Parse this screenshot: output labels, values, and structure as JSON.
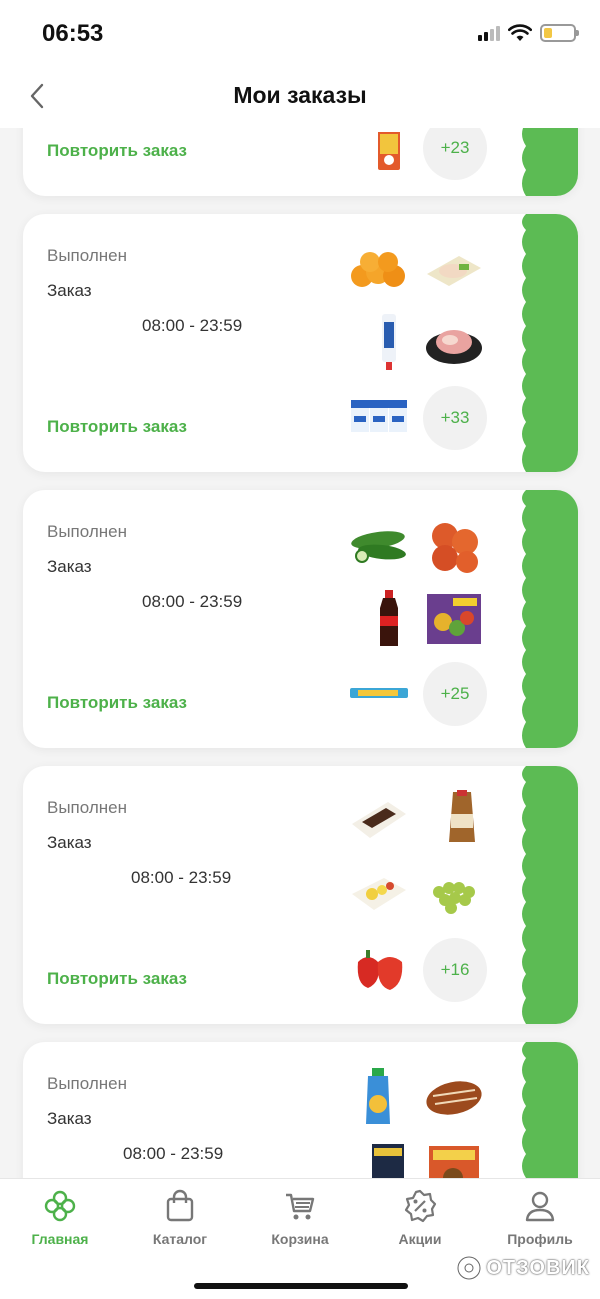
{
  "status_bar": {
    "time": "06:53"
  },
  "header": {
    "title": "Мои заказы"
  },
  "colors": {
    "accent": "#4db14a",
    "brand_strip": "#5cbb54"
  },
  "orders": [
    {
      "status": "",
      "order_label": "",
      "delivery_time": "",
      "repeat_label": "Повторить заказ",
      "more_count": "+23",
      "thumbnails": [
        "juice-box"
      ]
    },
    {
      "status": "Выполнен",
      "order_label": "Заказ",
      "delivery_time": "08:00 - 23:59",
      "repeat_label": "Повторить заказ",
      "more_count": "+33",
      "thumbnails": [
        "tangerines",
        "chicken-pack",
        "condensed-milk-tube",
        "raw-meat-plate",
        "milk-cartons"
      ]
    },
    {
      "status": "Выполнен",
      "order_label": "Заказ",
      "delivery_time": "08:00 - 23:59",
      "repeat_label": "Повторить заказ",
      "more_count": "+25",
      "thumbnails": [
        "cucumbers",
        "tomatoes",
        "cola-bottle",
        "frozen-vegetables-pack",
        "candy-bar"
      ]
    },
    {
      "status": "Выполнен",
      "order_label": "Заказ",
      "delivery_time": "08:00 - 23:59",
      "repeat_label": "Повторить заказ",
      "more_count": "+16",
      "thumbnails": [
        "cake-box",
        "bread-loaf",
        "cheese-tray",
        "green-grapes",
        "red-peppers"
      ]
    },
    {
      "status": "Выполнен",
      "order_label": "Заказ",
      "delivery_time": "08:00 - 23:59",
      "repeat_label": "",
      "more_count": "",
      "thumbnails": [
        "baby-puree-pouch",
        "smoked-ham",
        "coffee-pack",
        "snack-pack"
      ]
    }
  ],
  "tabbar": {
    "items": [
      {
        "label": "Главная",
        "icon": "clover-icon",
        "active": true
      },
      {
        "label": "Каталог",
        "icon": "bag-icon",
        "active": false
      },
      {
        "label": "Корзина",
        "icon": "cart-icon",
        "active": false
      },
      {
        "label": "Акции",
        "icon": "percent-badge-icon",
        "active": false
      },
      {
        "label": "Профиль",
        "icon": "person-icon",
        "active": false
      }
    ]
  },
  "watermark": {
    "text": "ОТЗОВИК"
  }
}
